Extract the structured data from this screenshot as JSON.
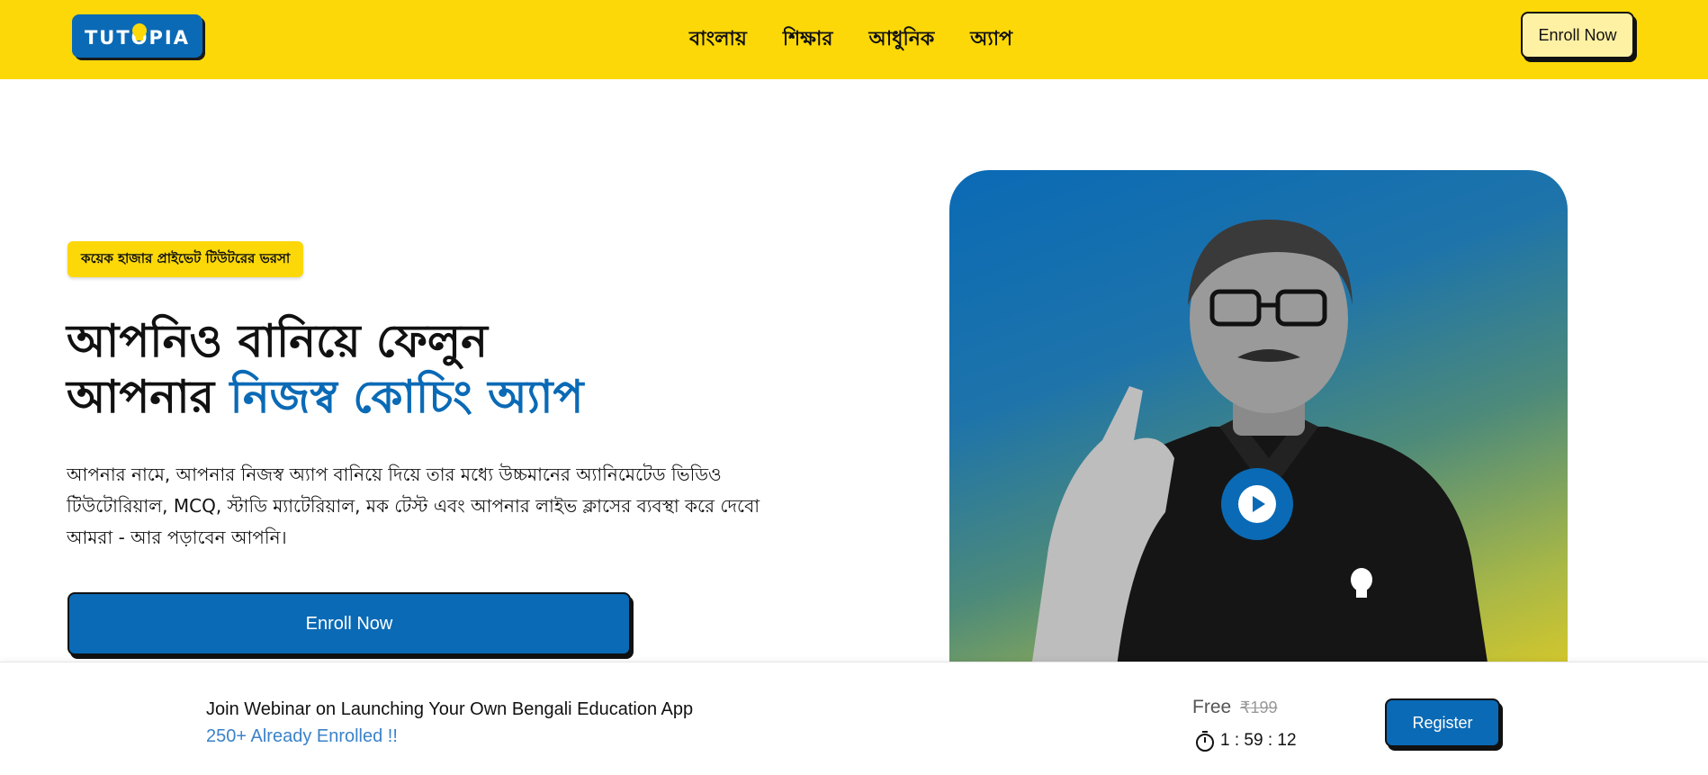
{
  "header": {
    "logo_text": "TUTOPIA",
    "nav": [
      "বাংলায়",
      "শিক্ষার",
      "আধুনিক",
      "অ্যাপ"
    ],
    "enroll_label": "Enroll Now"
  },
  "hero": {
    "tagline": "কয়েক হাজার প্রাইভেট টিউটরের ভরসা",
    "headline_line1": "আপনিও বানিয়ে ফেলুন",
    "headline_line2_prefix": "আপনার ",
    "headline_line2_highlight": "নিজস্ব কোচিং অ্যাপ",
    "description": "আপনার নামে, আপনার নিজস্ব অ্যাপ বানিয়ে দিয়ে তার মধ্যে উচ্চমানের অ্যানিমেটেড ভিডিও টিউটোরিয়াল, MCQ, স্টাডি ম্যাটেরিয়াল, মক টেস্ট এবং আপনার লাইভ ক্লাসের ব্যবস্থা করে দেবো আমরা - আর পড়াবেন আপনি।",
    "enroll_label": "Enroll Now"
  },
  "colors": {
    "brand_yellow": "#FCD808",
    "brand_blue": "#0A6AB5"
  },
  "webinar": {
    "title": "Join Webinar on Launching Your Own Bengali Education App",
    "enrolled": "250+ Already Enrolled !!",
    "price_free": "Free",
    "price_old": "₹199",
    "timer": "1 : 59 : 12",
    "register_label": "Register"
  }
}
